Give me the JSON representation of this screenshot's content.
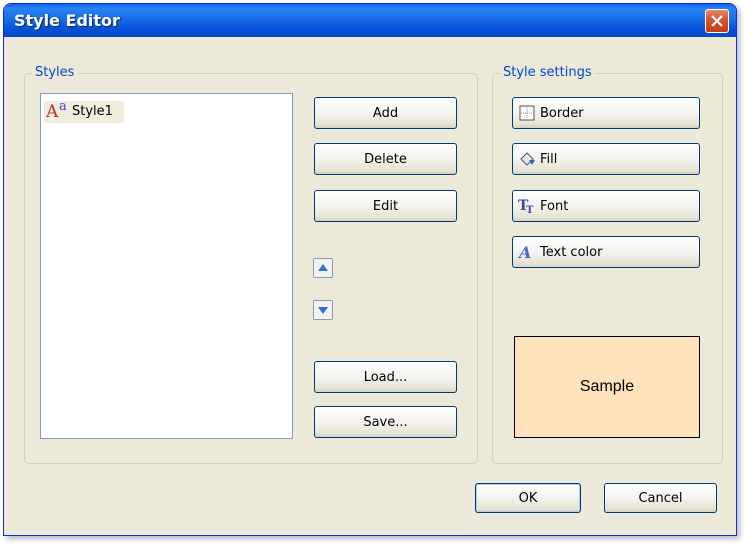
{
  "window": {
    "title": "Style Editor"
  },
  "styles_group": {
    "legend": "Styles",
    "items": [
      {
        "label": "Style1",
        "icon": "style-aa-icon"
      }
    ]
  },
  "buttons": {
    "add": "Add",
    "delete": "Delete",
    "edit": "Edit",
    "load": "Load...",
    "save": "Save..."
  },
  "settings_group": {
    "legend": "Style settings",
    "border": "Border",
    "fill": "Fill",
    "font": "Font",
    "text_color": "Text color",
    "sample": "Sample"
  },
  "footer": {
    "ok": "OK",
    "cancel": "Cancel"
  },
  "colors": {
    "sample_background": "#fee2bb",
    "legend_text": "#0046d5",
    "titlebar": "#0552d6"
  }
}
